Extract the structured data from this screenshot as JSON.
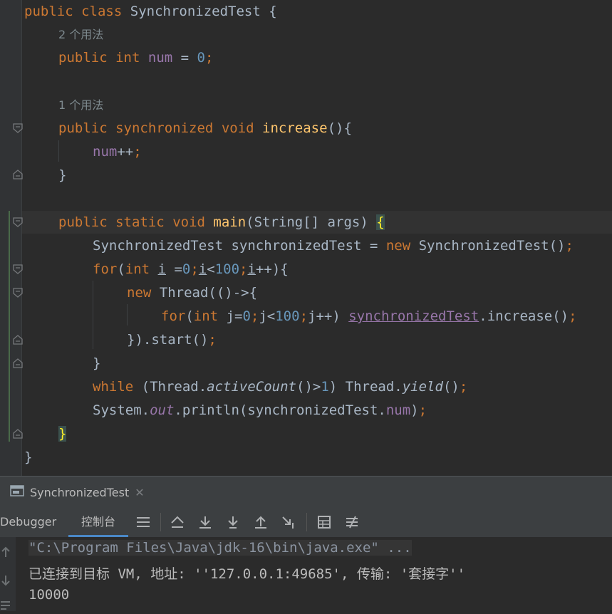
{
  "editor": {
    "lines": {
      "l1": {
        "k1": "public",
        "k2": "class",
        "name": "SynchronizedTest",
        "brace": " {"
      },
      "h1": "2 个用法",
      "l2": {
        "k1": "public",
        "k2": "int",
        "field": "num",
        "eq": " = ",
        "val": "0",
        "semi": ";"
      },
      "h2": "1 个用法",
      "l3": {
        "k1": "public",
        "k2": "synchronized",
        "k3": "void",
        "fn": "increase",
        "rest": "(){"
      },
      "l4": {
        "field": "num",
        "rest": "++",
        "semi": ";"
      },
      "l5": "}",
      "l6": {
        "k1": "public",
        "k2": "static",
        "k3": "void",
        "fn": "main",
        "rest": "(String[] args) ",
        "brace": "{"
      },
      "l7": {
        "a": "SynchronizedTest synchronizedTest = ",
        "kw": "new",
        "b": " SynchronizedTest()",
        "semi": ";"
      },
      "l8": {
        "kw": "for",
        "a": "(",
        "kw2": "int",
        "b": " ",
        "i1": "i",
        "c": " =",
        "n1": "0",
        "s1": ";",
        "i2": "i",
        "d": "<",
        "n2": "100",
        "s2": ";",
        "i3": "i",
        "e": "++){"
      },
      "l9": {
        "kw": "new",
        "a": " Thread(()->{"
      },
      "l10": {
        "kw": "for",
        "a": "(",
        "kw2": "int",
        "b": " j=",
        "n1": "0",
        "s1": ";",
        "c": "j<",
        "n2": "100",
        "s2": ";",
        "d": "j++) ",
        "var": "synchronizedTest",
        "e": ".increase()",
        "semi": ";"
      },
      "l11": {
        "a": "}).start()",
        "semi": ";"
      },
      "l12": "}",
      "l13": {
        "kw": "while",
        "a": " (Thread.",
        "m": "activeCount",
        "b": "()>",
        "n": "1",
        "c": ") Thread.",
        "m2": "yield",
        "d": "()",
        "semi": ";"
      },
      "l14": {
        "a": "System.",
        "f": "out",
        "b": ".println(synchronizedTest.",
        "f2": "num",
        "c": ")",
        "semi": ";"
      },
      "l15": "}",
      "l16": "}"
    }
  },
  "tool_window": {
    "run_tab_label": "SynchronizedTest",
    "close_glyph": "✕",
    "tabs": {
      "debugger": "Debugger",
      "console": "控制台"
    }
  },
  "console": {
    "cmd": "\"C:\\Program Files\\Java\\jdk-16\\bin\\java.exe\" ...",
    "connected": "已连接到目标 VM, 地址: ''127.0.0.1:49685', 传输: '套接字''",
    "output": "10000"
  },
  "colors": {
    "keyword": "#cc7832",
    "number": "#6897bb",
    "field": "#9876aa",
    "method": "#ffc66d",
    "text": "#a9b7c6",
    "accent": "#4a88c7"
  }
}
